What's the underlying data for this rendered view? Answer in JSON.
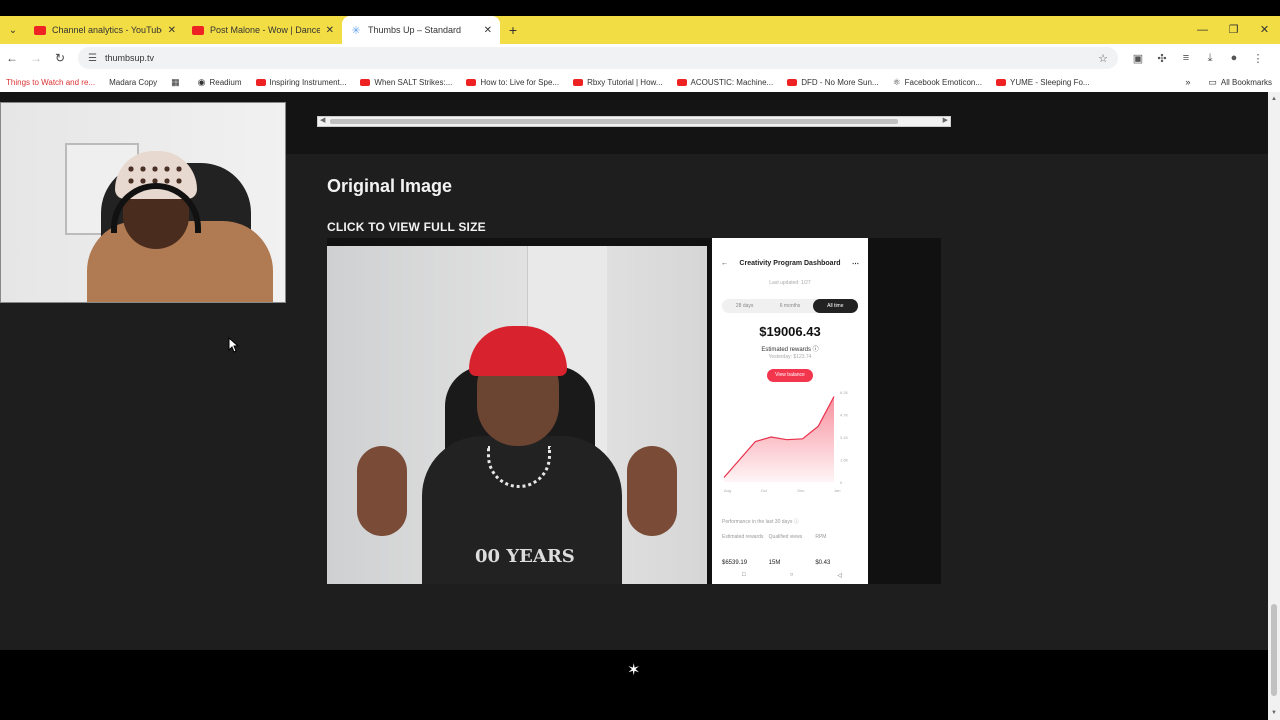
{
  "browser": {
    "tabs": [
      {
        "title": "Channel analytics - YouTube St",
        "icon": "youtube-icon",
        "active": false
      },
      {
        "title": "Post Malone - Wow | Dance Vic",
        "icon": "youtube-icon",
        "active": false
      },
      {
        "title": "Thumbs Up – Standard",
        "icon": "sparkle-icon",
        "active": true
      }
    ],
    "url": "thumbsup.tv",
    "bookmarks": [
      "Things to Watch and re...",
      "Madara Copy",
      "Readium",
      "Inspiring Instrument...",
      "When SALT Strikes:...",
      "How to: Live for Spe...",
      "Rbxy Tutorial | How...",
      "ACOUSTIC: Machine...",
      "DFD - No More Sun...",
      "Facebook Emoticon...",
      "YUME - Sleeping Fo..."
    ],
    "all_bookmarks": "All Bookmarks"
  },
  "page": {
    "heading": "Original Image",
    "cta": "CLICK TO VIEW FULL SIZE",
    "thumbnail": {
      "shirt_print": "00 YEARS",
      "phone": {
        "title": "Creativity Program Dashboard",
        "last_updated": "Last updated: 1/27",
        "segments": [
          "28 days",
          "6 months",
          "All time"
        ],
        "selected_segment": "All time",
        "amount": "$19006.43",
        "estimated_label": "Estimated rewards ⓘ",
        "yesterday": "Yesterday: $123.74",
        "button": "View balance",
        "x_ticks": [
          "Aug",
          "Oct",
          "Dec",
          "Jan"
        ],
        "y_ticks": [
          "6.2K",
          "4.7K",
          "3.1K",
          "1.6K",
          "0"
        ],
        "performance_label": "Performance in the last 30 days ⓘ",
        "stat_labels": [
          "Estimated rewards",
          "Qualified views",
          "RPM"
        ],
        "stat_values": [
          "$6539.19",
          "15M",
          "$0.43"
        ],
        "chart_values": [
          0.05,
          0.25,
          0.45,
          0.5,
          0.47,
          0.48,
          0.62,
          0.95
        ]
      }
    }
  },
  "colors": {
    "tabstrip": "#f3dd45",
    "page_bg": "#1e1e1e",
    "accent_red": "#f2364e"
  }
}
